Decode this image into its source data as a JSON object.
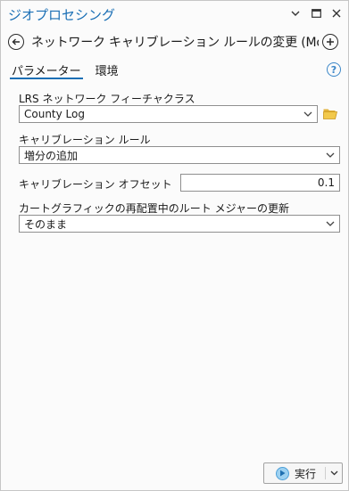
{
  "pane": {
    "title": "ジオプロセシング"
  },
  "tool": {
    "title": "ネットワーク キャリブレーション ルールの変更 (Modify N..."
  },
  "tabs": [
    {
      "label": "パラメーター",
      "active": true
    },
    {
      "label": "環境",
      "active": false
    }
  ],
  "params": {
    "network": {
      "label": "LRS ネットワーク フィーチャクラス",
      "value": "County Log"
    },
    "rule": {
      "label": "キャリブレーション ルール",
      "value": "増分の追加"
    },
    "offset": {
      "label": "キャリブレーション オフセット",
      "value": "0.1"
    },
    "cartographic": {
      "label": "カートグラフィックの再配置中のルート メジャーの更新",
      "value": "そのまま"
    }
  },
  "run": {
    "label": "実行"
  },
  "colors": {
    "accent": "#1a6fb5",
    "help": "#3a86c8"
  }
}
